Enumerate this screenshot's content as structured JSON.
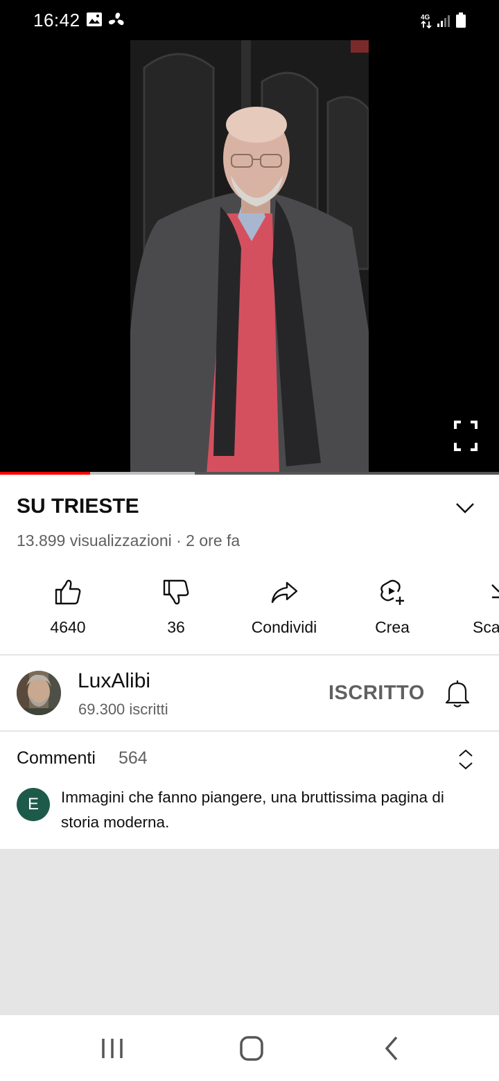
{
  "status_bar": {
    "time": "16:42",
    "network": "4G",
    "icons": [
      "image-icon",
      "fan-icon",
      "network-4g-icon",
      "signal-icon",
      "battery-icon"
    ]
  },
  "player": {
    "progress_played": 0.18,
    "progress_buffered": 0.39,
    "accent_color": "#ff0000"
  },
  "video": {
    "title": "SU TRIESTE",
    "meta": "13.899 visualizzazioni · 2 ore fa"
  },
  "actions": [
    {
      "label": "4640",
      "icon": "like-icon"
    },
    {
      "label": "36",
      "icon": "dislike-icon"
    },
    {
      "label": "Condividi",
      "icon": "share-icon"
    },
    {
      "label": "Crea",
      "icon": "create-icon"
    },
    {
      "label": "Sca",
      "icon": "download-icon"
    }
  ],
  "channel": {
    "name": "LuxAlibi",
    "subscribers": "69.300 iscritti",
    "subscribe_label": "ISCRITTO"
  },
  "comments": {
    "title": "Commenti",
    "count": "564",
    "top_comment": {
      "avatar_letter": "E",
      "text": "Immagini che fanno piangere, una bruttissima pagina di storia moderna."
    }
  },
  "nav": {
    "icons": [
      "recent-apps-icon",
      "home-icon",
      "back-icon"
    ]
  }
}
